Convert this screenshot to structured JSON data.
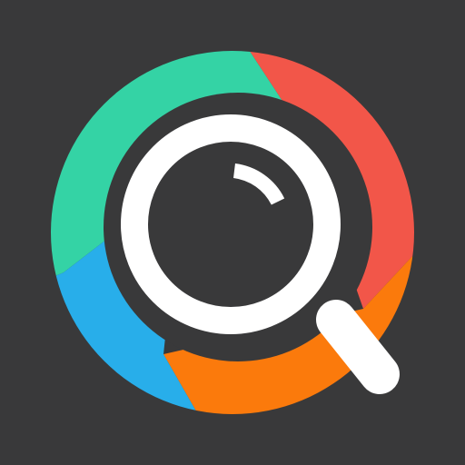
{
  "icon": {
    "name": "search-icon",
    "colors": {
      "background": "#39393a",
      "ring_green": "#34d3a5",
      "ring_red": "#f25649",
      "ring_orange": "#fb7a0c",
      "ring_blue": "#28aeea",
      "inner_dark": "#39393a",
      "magnifier": "#ffffff"
    }
  }
}
